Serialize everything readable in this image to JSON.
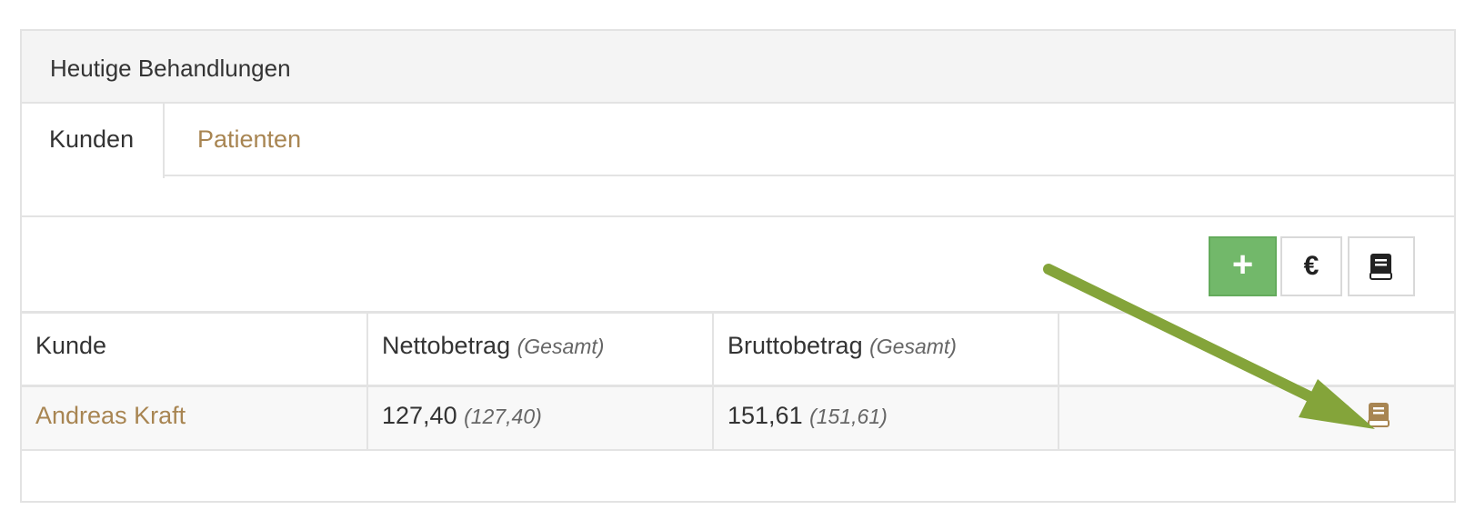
{
  "panel": {
    "title": "Heutige Behandlungen"
  },
  "tabs": [
    {
      "label": "Kunden",
      "active": true
    },
    {
      "label": "Patienten",
      "active": false
    }
  ],
  "toolbar": {
    "add_label": "+",
    "invoice_label": "€",
    "book_icon": "book-icon"
  },
  "table": {
    "headers": {
      "customer": "Kunde",
      "net": "Nettobetrag",
      "net_note": "(Gesamt)",
      "gross": "Bruttobetrag",
      "gross_note": "(Gesamt)"
    },
    "rows": [
      {
        "customer": "Andreas Kraft",
        "net": "127,40",
        "net_total": "(127,40)",
        "gross": "151,61",
        "gross_total": "(151,61)",
        "actions": {
          "invoice": "€",
          "book": "book-icon"
        }
      }
    ]
  },
  "colors": {
    "accent_link": "#a88552",
    "add_button": "#72b86a",
    "annotation_arrow": "#84a43a"
  }
}
